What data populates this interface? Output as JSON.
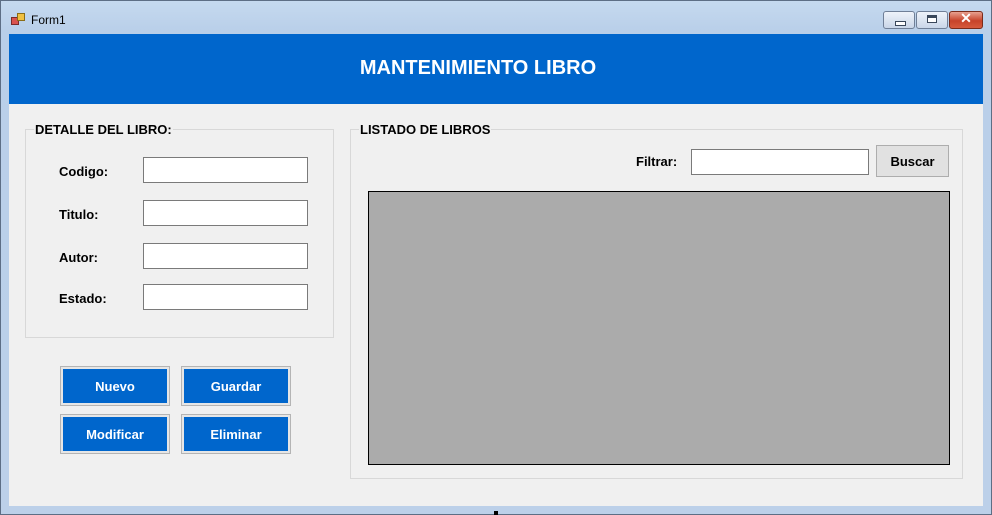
{
  "window": {
    "title": "Form1",
    "close_glyph": "✕"
  },
  "header": {
    "title": "MANTENIMIENTO LIBRO"
  },
  "detalle": {
    "group_title": "DETALLE DEL LIBRO:",
    "fields": {
      "codigo": {
        "label": "Codigo:",
        "value": ""
      },
      "titulo": {
        "label": "Titulo:",
        "value": ""
      },
      "autor": {
        "label": "Autor:",
        "value": ""
      },
      "estado": {
        "label": "Estado:",
        "value": ""
      }
    }
  },
  "actions": {
    "nuevo": "Nuevo",
    "guardar": "Guardar",
    "modificar": "Modificar",
    "eliminar": "Eliminar"
  },
  "listado": {
    "group_title": "LISTADO DE LIBROS",
    "filter_label": "Filtrar:",
    "filter_value": "",
    "search_button": "Buscar"
  },
  "colors": {
    "header": "#0066cc",
    "button": "#0066cc",
    "grid": "#ababab",
    "client": "#f0f0f0"
  },
  "icons": {
    "app": "form-app-icon",
    "minimize": "minimize-icon",
    "maximize": "maximize-icon",
    "close": "close-icon"
  }
}
